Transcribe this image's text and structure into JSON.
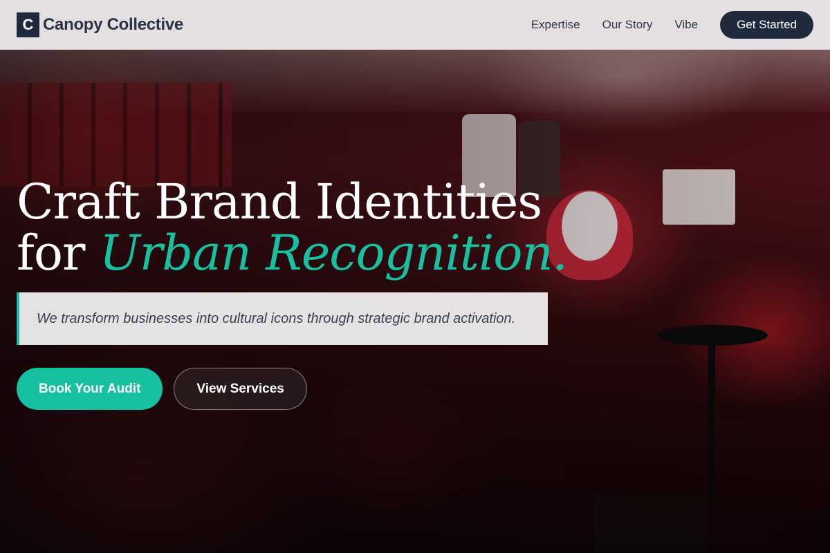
{
  "header": {
    "logo_letter": "C",
    "brand_name": "Canopy Collective",
    "nav": [
      {
        "label": "Expertise"
      },
      {
        "label": "Our Story"
      },
      {
        "label": "Vibe"
      }
    ],
    "cta_label": "Get Started"
  },
  "hero": {
    "headline_line1": "Craft Brand Identities",
    "headline_for": "for",
    "headline_accent": "Urban Recognition.",
    "subtext": "We transform businesses into cultural icons through strategic brand activation.",
    "primary_button": "Book Your Audit",
    "secondary_button": "View Services"
  },
  "colors": {
    "accent": "#16c0a0",
    "navy": "#1f2a3d",
    "header_bg": "#ece8ea"
  }
}
